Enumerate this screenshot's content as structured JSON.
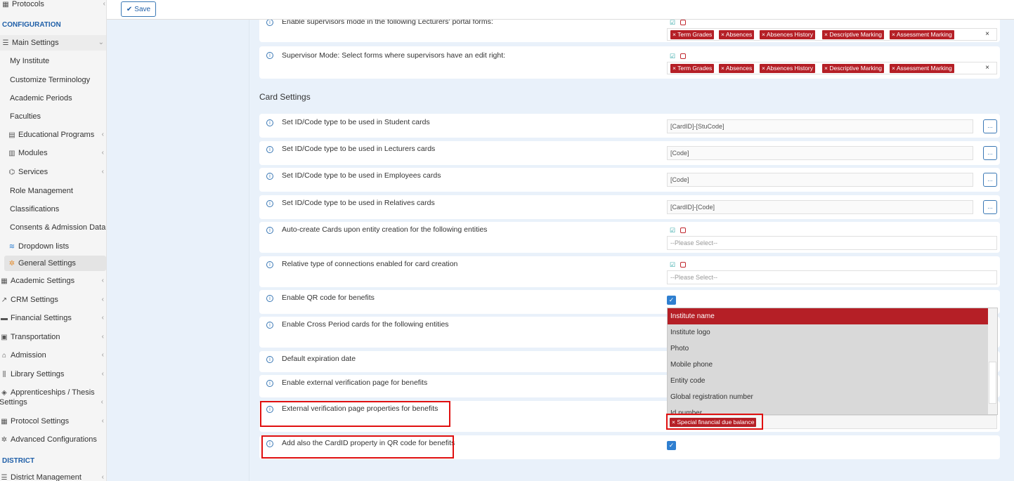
{
  "toolbar": {
    "save_label": "Save"
  },
  "sidebar": {
    "protocols": "Protocols",
    "configuration_heading": "CONFIGURATION",
    "main_settings": "Main Settings",
    "items": [
      "My Institute",
      "Customize Terminology",
      "Academic Periods",
      "Faculties",
      "Educational Programs",
      "Modules",
      "Services",
      "Role Management",
      "Classifications",
      "Consents & Admission Data",
      "Dropdown lists",
      "General Settings"
    ],
    "groups": [
      "Academic Settings",
      "CRM Settings",
      "Financial Settings",
      "Transportation",
      "Admission",
      "Library Settings",
      "Apprenticeships / Thesis",
      "Settings",
      "Protocol Settings",
      "Advanced Configurations"
    ],
    "district_heading": "DISTRICT",
    "district_management": "District Management"
  },
  "supervisor": {
    "enable_label": "Enable supervisors mode in the following Lecturers' portal forms:",
    "edit_label": "Supervisor Mode: Select forms where supervisors have an edit right:",
    "tags": [
      "Term Grades",
      "Absences",
      "Absences History",
      "Descriptive Marking",
      "Assessment Marking"
    ]
  },
  "card_settings": {
    "title": "Card Settings",
    "student_label": "Set ID/Code type to be used in Student cards",
    "student_value": "[CardID]-[StuCode]",
    "lecturers_label": "Set ID/Code type to be used in Lecturers cards",
    "lecturers_value": "[Code]",
    "employees_label": "Set ID/Code type to be used in Employees cards",
    "employees_value": "[Code]",
    "relatives_label": "Set ID/Code type to be used in Relatives cards",
    "relatives_value": "[CardID]-[Code]",
    "dots": "...",
    "autocreate_label": "Auto-create Cards upon entity creation for the following entities",
    "relative_type_label": "Relative type of connections enabled for card creation",
    "please_select": "--Please Select--",
    "qr_label": "Enable QR code for benefits",
    "cross_period_label": "Enable Cross Period cards for the following entities",
    "default_exp_label": "Default expiration date",
    "ext_verif_label": "Enable external verification page for benefits",
    "ext_props_label": "External verification page properties for benefits",
    "ext_props_tag": "Special financial due balance",
    "cardid_qr_label": "Add also the CardID property in QR code for benefits"
  },
  "dropdown": {
    "options": [
      "Institute name",
      "Institute logo",
      "Photo",
      "Mobile phone",
      "Entity code",
      "Global registration number",
      "Id number"
    ]
  },
  "colors": {
    "accent": "#3a78b5",
    "tag": "#b51f26",
    "highlight": "#e01010"
  }
}
